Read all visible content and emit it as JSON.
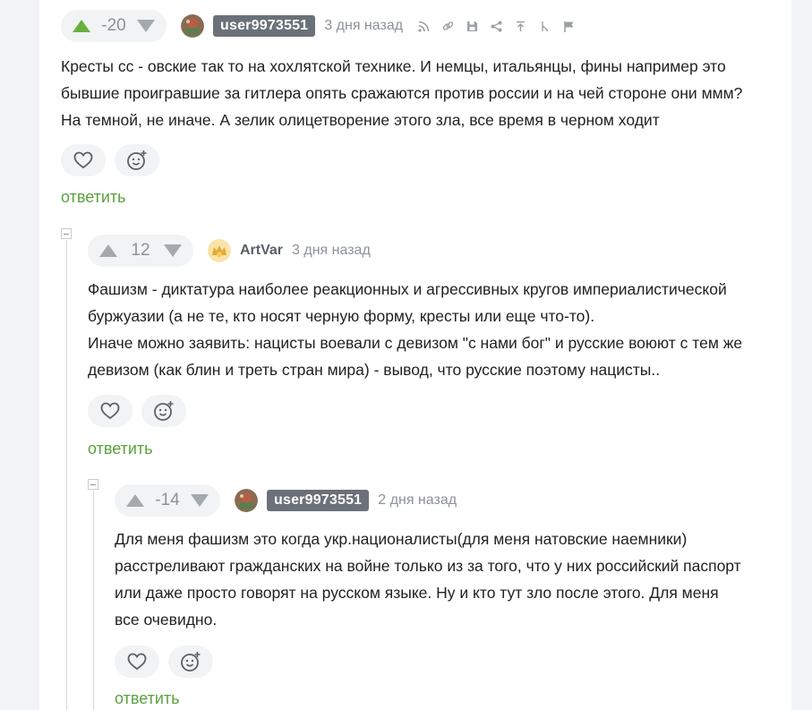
{
  "colors": {
    "upvote_active": "#6aaf3d",
    "vote_gray": "#8d9298",
    "reply_green": "#5aa23d",
    "badge_bg": "#6b7178"
  },
  "comments": [
    {
      "rating": "-20",
      "author": "user9973551",
      "time": "3 дня назад",
      "text": [
        "Кресты сс - овские так то на хохлятской технике. И немцы, итальянцы, фины например это",
        "бывшие проигравшие за гитлера опять сражаются против россии и на чей стороне они ммм?",
        "На темной, не иначе. А зелик олицетворение этого зла, все время в черном ходит"
      ],
      "reply_label": "ответить",
      "icons": [
        "upvote-icon",
        "downvote-icon",
        "rss-icon",
        "link-icon",
        "save-icon",
        "share-icon",
        "go-to-parent-icon",
        "branch-icon",
        "report-flag-icon",
        "heart-icon",
        "emoji-add-icon"
      ]
    },
    {
      "rating": "12",
      "author": "ArtVar",
      "time": "3 дня назад",
      "text": [
        "Фашизм - диктатура наиболее реакционных и агрессивных кругов империалистической",
        "буржуазии (а не те, кто носят черную форму, кресты или еще что-то).",
        "Иначе можно заявить: нацисты воевали с девизом \"с нами бог\" и русские воюют с тем же",
        "девизом (как блин и треть стран мира) - вывод, что русские поэтому нацисты.."
      ],
      "reply_label": "ответить",
      "icons": [
        "upvote-icon",
        "downvote-icon",
        "heart-icon",
        "emoji-add-icon",
        "collapse-icon"
      ]
    },
    {
      "rating": "-14",
      "author": "user9973551",
      "time": "2 дня назад",
      "text": [
        "Для меня фашизм это когда укр.националисты(для меня натовские наемники)",
        "расстреливают гражданских на войне только из за того, что у них российский паспорт",
        "или даже просто говорят на русском языке. Ну и кто тут зло после этого. Для меня",
        "все очевидно."
      ],
      "reply_label": "ответить",
      "icons": [
        "upvote-icon",
        "downvote-icon",
        "heart-icon",
        "emoji-add-icon",
        "collapse-icon"
      ]
    }
  ]
}
